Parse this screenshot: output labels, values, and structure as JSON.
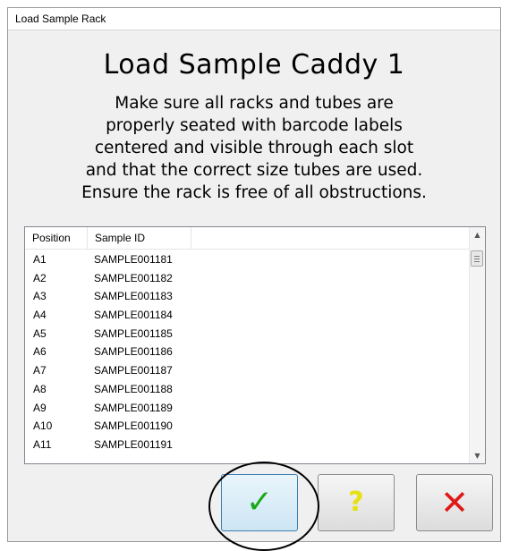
{
  "window": {
    "title": "Load Sample Rack"
  },
  "heading": "Load Sample Caddy 1",
  "instructions": [
    "Make sure all racks and tubes are",
    "properly seated with barcode labels",
    "centered and visible through each slot",
    "and that the correct size tubes are used.",
    "Ensure the rack is free of all obstructions."
  ],
  "table": {
    "columns": [
      "Position",
      "Sample ID"
    ],
    "rows": [
      [
        "A1",
        "SAMPLE001181"
      ],
      [
        "A2",
        "SAMPLE001182"
      ],
      [
        "A3",
        "SAMPLE001183"
      ],
      [
        "A4",
        "SAMPLE001184"
      ],
      [
        "A5",
        "SAMPLE001185"
      ],
      [
        "A6",
        "SAMPLE001186"
      ],
      [
        "A7",
        "SAMPLE001187"
      ],
      [
        "A8",
        "SAMPLE001188"
      ],
      [
        "A9",
        "SAMPLE001189"
      ],
      [
        "A10",
        "SAMPLE001190"
      ],
      [
        "A11",
        "SAMPLE001191"
      ]
    ]
  },
  "buttons": {
    "ok": {
      "glyph": "✓",
      "icon": "checkmark-icon",
      "color": "#18a818"
    },
    "help": {
      "glyph": "?",
      "icon": "question-icon",
      "color": "#e8e010"
    },
    "cancel": {
      "glyph": "✕",
      "icon": "close-icon",
      "color": "#e01818"
    }
  },
  "scrollbar": {
    "up_glyph": "▲",
    "down_glyph": "▼"
  }
}
